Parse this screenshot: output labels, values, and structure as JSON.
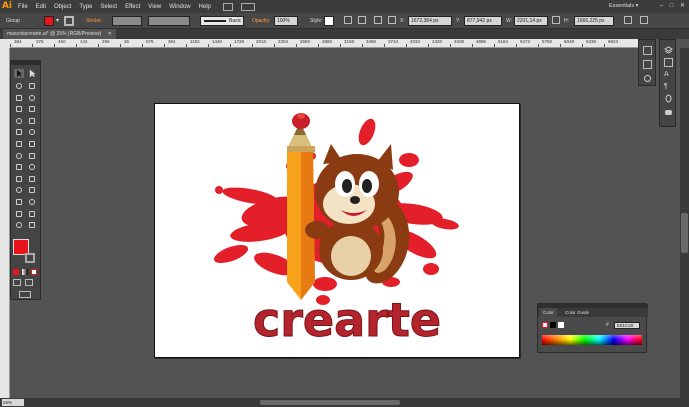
{
  "menubar": {
    "logo": "Ai",
    "items": [
      "File",
      "Edit",
      "Object",
      "Type",
      "Select",
      "Effect",
      "View",
      "Window",
      "Help"
    ],
    "workspace": "Essentials",
    "workspace_arrow": "▾",
    "minimize": "–",
    "restore": "□",
    "close": "✕"
  },
  "control": {
    "selection": "Group",
    "stroke_label": "Stroke:",
    "brush_label": "Basic",
    "opacity_label": "Opacity:",
    "opacity_value": "100%",
    "style_label": "Style:",
    "x_value": "1672,384 px",
    "y_value": "877,942 px",
    "w_value": "2201,14 px",
    "h_value": "1666,225 px"
  },
  "document": {
    "tab_label": "mascotacrearte.ai* @ 25% (RGB/Preview)",
    "close": "✕"
  },
  "ruler": {
    "top_ticks": [
      "384",
      "376",
      "460",
      "144",
      "256",
      "36",
      "576",
      "364",
      "1152",
      "1440",
      "1728",
      "2016",
      "2304",
      "2592",
      "2880",
      "3168",
      "3456",
      "3744",
      "4032",
      "4320",
      "4608",
      "4896",
      "5184",
      "5472",
      "5760",
      "6048",
      "6336",
      "6624"
    ]
  },
  "artwork": {
    "title": "crearte"
  },
  "color_panel": {
    "tab_color": "Color",
    "tab_guide": "Color Guide",
    "hex": "E81C20"
  },
  "status": {
    "zoom": "25%"
  },
  "colors": {
    "accent": "#e8141c",
    "splash": "#e3202a",
    "brand_orange": "#ff9a00",
    "pencil_orange": "#f7a21b",
    "squirrel_brown": "#8a3b12",
    "title_red": "#b4242c"
  },
  "icons": {
    "selection": "arrow-icon",
    "direct_selection": "hollow-arrow-icon",
    "pen": "pen-icon",
    "type": "type-icon"
  }
}
